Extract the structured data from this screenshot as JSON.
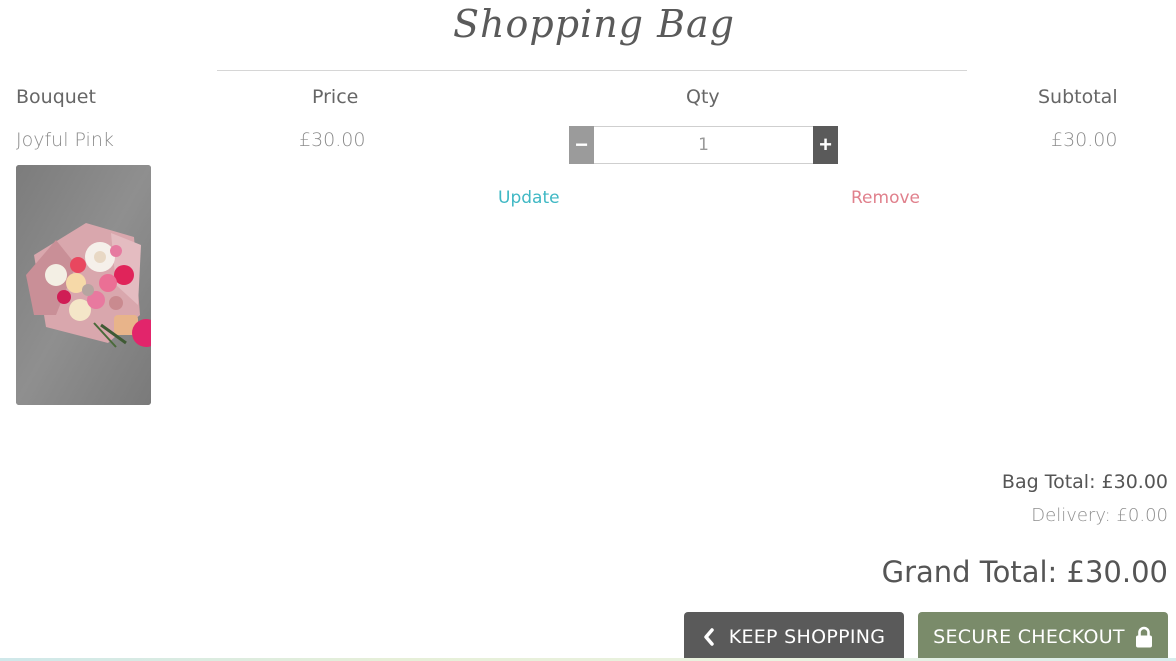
{
  "page": {
    "title": "Shopping Bag"
  },
  "table": {
    "headers": {
      "bouquet": "Bouquet",
      "price": "Price",
      "qty": "Qty",
      "subtotal": "Subtotal"
    }
  },
  "item": {
    "name": "Joyful Pink",
    "price": "£30.00",
    "quantity": "1",
    "subtotal": "£30.00",
    "update_label": "Update",
    "remove_label": "Remove",
    "decrement_label": "−",
    "increment_label": "+"
  },
  "summary": {
    "bag_total": "Bag Total: £30.00",
    "delivery": "Delivery: £0.00",
    "grand_total": "Grand Total: £30.00"
  },
  "actions": {
    "keep_shopping": "KEEP SHOPPING",
    "secure_checkout": "SECURE CHECKOUT"
  },
  "colors": {
    "update_link": "#3fb8c4",
    "remove_link": "#e0808c",
    "keep_shopping_bg": "#5a5a5a",
    "checkout_bg": "#7a8b6a"
  },
  "icons": {
    "keep_shopping": "chevron-left-icon",
    "checkout": "lock-icon"
  }
}
